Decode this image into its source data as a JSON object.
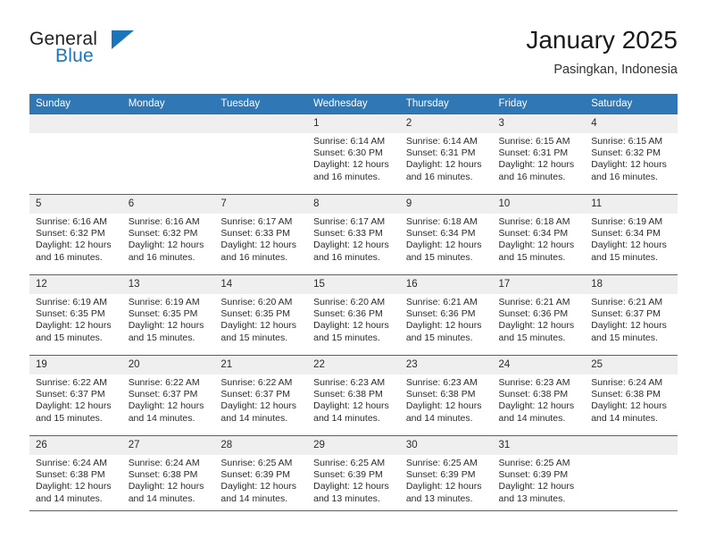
{
  "brand": {
    "word_one": "General",
    "word_two": "Blue",
    "triangle_icon": "triangle-logo-icon",
    "colors": {
      "general": "#231f20",
      "blue": "#1b75bb"
    }
  },
  "header": {
    "title": "January 2025",
    "subtitle": "Pasingkan, Indonesia"
  },
  "theme": {
    "header_bg": "#3077b5",
    "row_rule": "#2b6cab",
    "daynum_bg": "#efefef",
    "text": "#2b2b2b"
  },
  "calendar": {
    "weekday_headers": [
      "Sunday",
      "Monday",
      "Tuesday",
      "Wednesday",
      "Thursday",
      "Friday",
      "Saturday"
    ],
    "weeks": [
      [
        {
          "day": "",
          "empty": true,
          "lines": []
        },
        {
          "day": "",
          "empty": true,
          "lines": []
        },
        {
          "day": "",
          "empty": true,
          "lines": []
        },
        {
          "day": "1",
          "empty": false,
          "lines": [
            "Sunrise: 6:14 AM",
            "Sunset: 6:30 PM",
            "Daylight: 12 hours",
            "and 16 minutes."
          ]
        },
        {
          "day": "2",
          "empty": false,
          "lines": [
            "Sunrise: 6:14 AM",
            "Sunset: 6:31 PM",
            "Daylight: 12 hours",
            "and 16 minutes."
          ]
        },
        {
          "day": "3",
          "empty": false,
          "lines": [
            "Sunrise: 6:15 AM",
            "Sunset: 6:31 PM",
            "Daylight: 12 hours",
            "and 16 minutes."
          ]
        },
        {
          "day": "4",
          "empty": false,
          "lines": [
            "Sunrise: 6:15 AM",
            "Sunset: 6:32 PM",
            "Daylight: 12 hours",
            "and 16 minutes."
          ]
        }
      ],
      [
        {
          "day": "5",
          "empty": false,
          "lines": [
            "Sunrise: 6:16 AM",
            "Sunset: 6:32 PM",
            "Daylight: 12 hours",
            "and 16 minutes."
          ]
        },
        {
          "day": "6",
          "empty": false,
          "lines": [
            "Sunrise: 6:16 AM",
            "Sunset: 6:32 PM",
            "Daylight: 12 hours",
            "and 16 minutes."
          ]
        },
        {
          "day": "7",
          "empty": false,
          "lines": [
            "Sunrise: 6:17 AM",
            "Sunset: 6:33 PM",
            "Daylight: 12 hours",
            "and 16 minutes."
          ]
        },
        {
          "day": "8",
          "empty": false,
          "lines": [
            "Sunrise: 6:17 AM",
            "Sunset: 6:33 PM",
            "Daylight: 12 hours",
            "and 16 minutes."
          ]
        },
        {
          "day": "9",
          "empty": false,
          "lines": [
            "Sunrise: 6:18 AM",
            "Sunset: 6:34 PM",
            "Daylight: 12 hours",
            "and 15 minutes."
          ]
        },
        {
          "day": "10",
          "empty": false,
          "lines": [
            "Sunrise: 6:18 AM",
            "Sunset: 6:34 PM",
            "Daylight: 12 hours",
            "and 15 minutes."
          ]
        },
        {
          "day": "11",
          "empty": false,
          "lines": [
            "Sunrise: 6:19 AM",
            "Sunset: 6:34 PM",
            "Daylight: 12 hours",
            "and 15 minutes."
          ]
        }
      ],
      [
        {
          "day": "12",
          "empty": false,
          "lines": [
            "Sunrise: 6:19 AM",
            "Sunset: 6:35 PM",
            "Daylight: 12 hours",
            "and 15 minutes."
          ]
        },
        {
          "day": "13",
          "empty": false,
          "lines": [
            "Sunrise: 6:19 AM",
            "Sunset: 6:35 PM",
            "Daylight: 12 hours",
            "and 15 minutes."
          ]
        },
        {
          "day": "14",
          "empty": false,
          "lines": [
            "Sunrise: 6:20 AM",
            "Sunset: 6:35 PM",
            "Daylight: 12 hours",
            "and 15 minutes."
          ]
        },
        {
          "day": "15",
          "empty": false,
          "lines": [
            "Sunrise: 6:20 AM",
            "Sunset: 6:36 PM",
            "Daylight: 12 hours",
            "and 15 minutes."
          ]
        },
        {
          "day": "16",
          "empty": false,
          "lines": [
            "Sunrise: 6:21 AM",
            "Sunset: 6:36 PM",
            "Daylight: 12 hours",
            "and 15 minutes."
          ]
        },
        {
          "day": "17",
          "empty": false,
          "lines": [
            "Sunrise: 6:21 AM",
            "Sunset: 6:36 PM",
            "Daylight: 12 hours",
            "and 15 minutes."
          ]
        },
        {
          "day": "18",
          "empty": false,
          "lines": [
            "Sunrise: 6:21 AM",
            "Sunset: 6:37 PM",
            "Daylight: 12 hours",
            "and 15 minutes."
          ]
        }
      ],
      [
        {
          "day": "19",
          "empty": false,
          "lines": [
            "Sunrise: 6:22 AM",
            "Sunset: 6:37 PM",
            "Daylight: 12 hours",
            "and 15 minutes."
          ]
        },
        {
          "day": "20",
          "empty": false,
          "lines": [
            "Sunrise: 6:22 AM",
            "Sunset: 6:37 PM",
            "Daylight: 12 hours",
            "and 14 minutes."
          ]
        },
        {
          "day": "21",
          "empty": false,
          "lines": [
            "Sunrise: 6:22 AM",
            "Sunset: 6:37 PM",
            "Daylight: 12 hours",
            "and 14 minutes."
          ]
        },
        {
          "day": "22",
          "empty": false,
          "lines": [
            "Sunrise: 6:23 AM",
            "Sunset: 6:38 PM",
            "Daylight: 12 hours",
            "and 14 minutes."
          ]
        },
        {
          "day": "23",
          "empty": false,
          "lines": [
            "Sunrise: 6:23 AM",
            "Sunset: 6:38 PM",
            "Daylight: 12 hours",
            "and 14 minutes."
          ]
        },
        {
          "day": "24",
          "empty": false,
          "lines": [
            "Sunrise: 6:23 AM",
            "Sunset: 6:38 PM",
            "Daylight: 12 hours",
            "and 14 minutes."
          ]
        },
        {
          "day": "25",
          "empty": false,
          "lines": [
            "Sunrise: 6:24 AM",
            "Sunset: 6:38 PM",
            "Daylight: 12 hours",
            "and 14 minutes."
          ]
        }
      ],
      [
        {
          "day": "26",
          "empty": false,
          "lines": [
            "Sunrise: 6:24 AM",
            "Sunset: 6:38 PM",
            "Daylight: 12 hours",
            "and 14 minutes."
          ]
        },
        {
          "day": "27",
          "empty": false,
          "lines": [
            "Sunrise: 6:24 AM",
            "Sunset: 6:38 PM",
            "Daylight: 12 hours",
            "and 14 minutes."
          ]
        },
        {
          "day": "28",
          "empty": false,
          "lines": [
            "Sunrise: 6:25 AM",
            "Sunset: 6:39 PM",
            "Daylight: 12 hours",
            "and 14 minutes."
          ]
        },
        {
          "day": "29",
          "empty": false,
          "lines": [
            "Sunrise: 6:25 AM",
            "Sunset: 6:39 PM",
            "Daylight: 12 hours",
            "and 13 minutes."
          ]
        },
        {
          "day": "30",
          "empty": false,
          "lines": [
            "Sunrise: 6:25 AM",
            "Sunset: 6:39 PM",
            "Daylight: 12 hours",
            "and 13 minutes."
          ]
        },
        {
          "day": "31",
          "empty": false,
          "lines": [
            "Sunrise: 6:25 AM",
            "Sunset: 6:39 PM",
            "Daylight: 12 hours",
            "and 13 minutes."
          ]
        },
        {
          "day": "",
          "empty": true,
          "lines": []
        }
      ]
    ]
  }
}
